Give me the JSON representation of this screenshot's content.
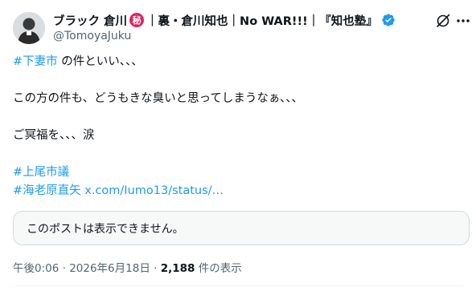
{
  "author": {
    "display_name_part1": "ブラック 倉川",
    "secret_badge": "秘",
    "display_name_part2": "｜裏・倉川知也｜No WAR!!!｜『知也塾』",
    "handle": "@TomoyaJuku"
  },
  "post": {
    "line1_hashtag": "#下妻市",
    "line1_text": " の件といい、、、",
    "line2": "この方の件も、どうもきな臭いと思ってしまうなぁ、、、",
    "line3": "ご冥福を、、、涙",
    "hashtag2": "#上尾市議",
    "hashtag3": "#海老原直矢",
    "link_text": " x.com/Iumo13/status/…"
  },
  "quote": {
    "unavailable_text": "このポストは表示できません。"
  },
  "meta": {
    "time": "午後0:06",
    "sep1": " · ",
    "date": "2026年6月18日",
    "sep2": " · ",
    "views_count": "2,188",
    "views_label": " 件の表示"
  },
  "icons": {
    "verified": "verified-badge-icon",
    "grok": "grok-icon",
    "more": "more-icon"
  },
  "colors": {
    "link": "#1d9bf0",
    "secret_badge": "#e0245e",
    "secondary_text": "#536471"
  }
}
